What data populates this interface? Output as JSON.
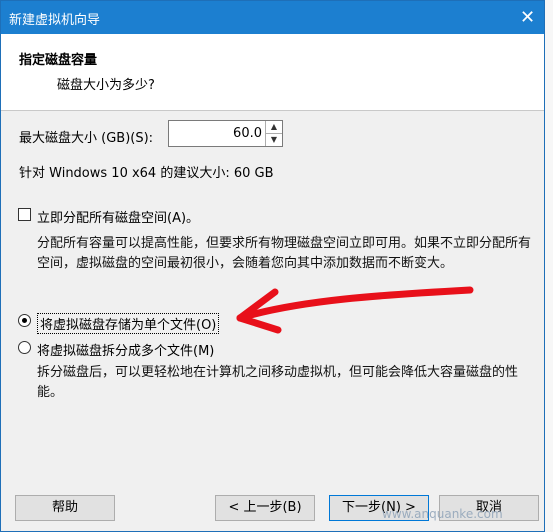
{
  "window": {
    "title": "新建虚拟机向导",
    "close_glyph": "✕"
  },
  "header": {
    "title": "指定磁盘容量",
    "subtitle": "磁盘大小为多少?"
  },
  "disk": {
    "size_label": "最大磁盘大小 (GB)(S):",
    "size_value": "60.0",
    "recommendation": "针对 Windows 10 x64 的建议大小: 60 GB"
  },
  "allocate": {
    "checkbox_label": "立即分配所有磁盘空间(A)。",
    "checked": false,
    "description": "分配所有容量可以提高性能，但要求所有物理磁盘空间立即可用。如果不立即分配所有空间，虚拟磁盘的空间最初很小，会随着您向其中添加数据而不断变大。"
  },
  "storage_options": {
    "option_single": "将虚拟磁盘存储为单个文件(O)",
    "option_multiple": "将虚拟磁盘拆分成多个文件(M)",
    "selected": "single",
    "multiple_description": "拆分磁盘后，可以更轻松地在计算机之间移动虚拟机，但可能会降低大容量磁盘的性能。"
  },
  "buttons": {
    "help": "帮助",
    "back": "< 上一步(B)",
    "next": "下一步(N) >",
    "cancel": "取消"
  },
  "watermark": "www.anquanke.com",
  "annotation_color": "#e8101a"
}
